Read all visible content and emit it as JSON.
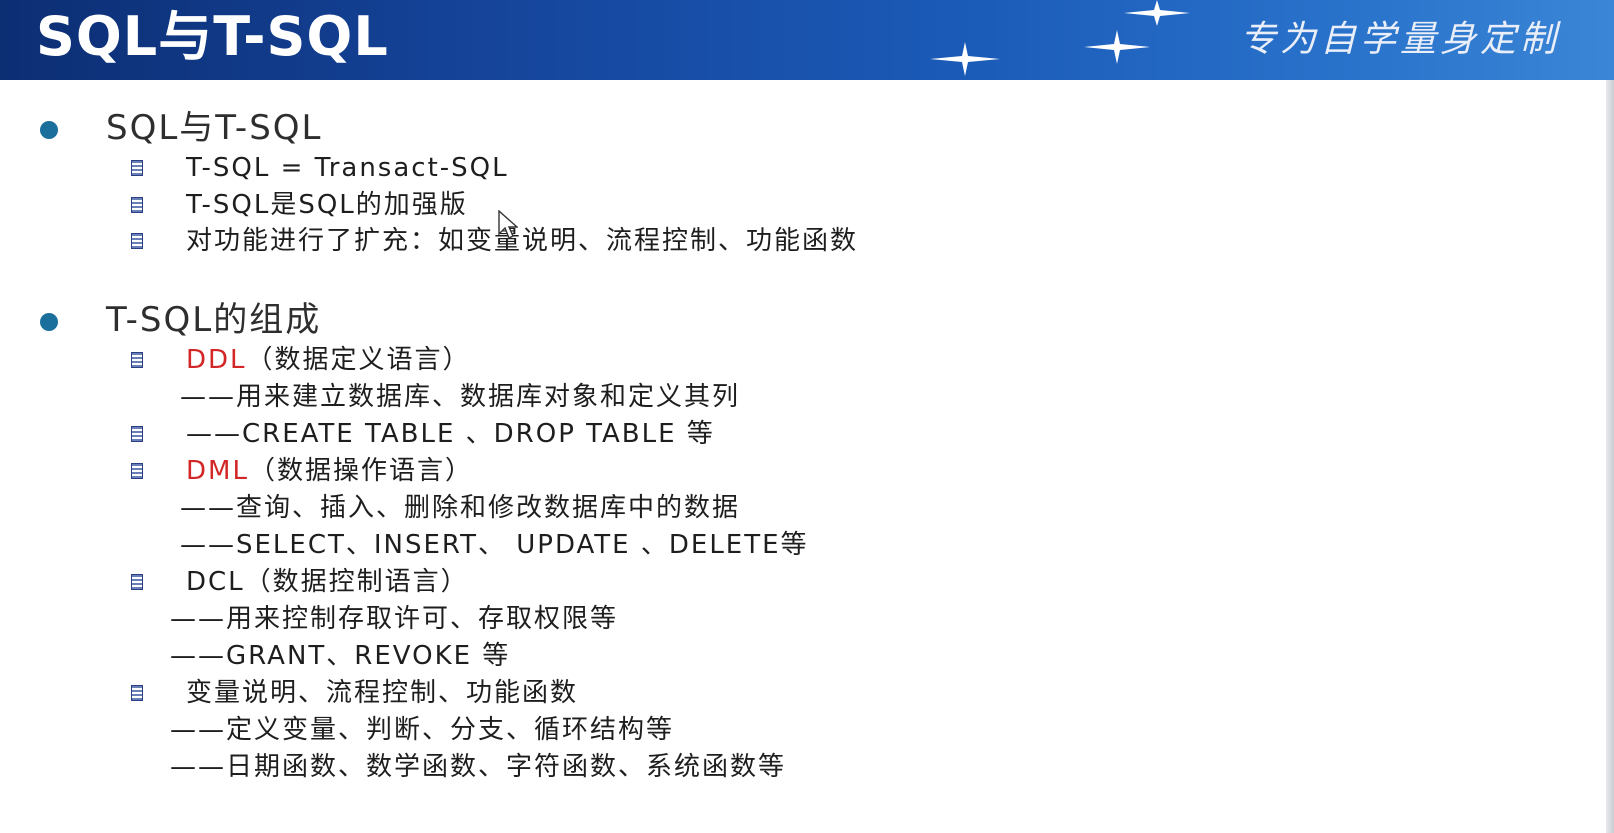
{
  "header": {
    "title": "SQL与T-SQL",
    "slogan": "专为自学量身定制"
  },
  "sections": [
    {
      "heading": "SQL与T-SQL",
      "items": [
        "T-SQL  = Transact-SQL",
        "T-SQL是SQL的加强版",
        "对功能进行了扩充：如变量说明、流程控制、功能函数"
      ]
    },
    {
      "heading": "T-SQL的组成",
      "ddl": {
        "term": "DDL",
        "rest": "（数据定义语言）",
        "desc": "——用来建立数据库、数据库对象和定义其列",
        "example": "——CREATE TABLE 、DROP TABLE 等"
      },
      "dml": {
        "term": "DML",
        "rest": "（数据操作语言）",
        "desc": "——查询、插入、删除和修改数据库中的数据",
        "example": "——SELECT、INSERT、 UPDATE 、DELETE等"
      },
      "dcl": {
        "label": "DCL（数据控制语言）",
        "desc": "——用来控制存取许可、存取权限等",
        "example": "——GRANT、REVOKE 等"
      },
      "other": {
        "label": "变量说明、流程控制、功能函数",
        "desc": "——定义变量、判断、分支、循环结构等",
        "example": "——日期函数、数学函数、字符函数、系统函数等"
      }
    }
  ],
  "colors": {
    "banner": "#1b5bb8",
    "bullet": "#1a6f9c",
    "highlight": "#d32626"
  }
}
